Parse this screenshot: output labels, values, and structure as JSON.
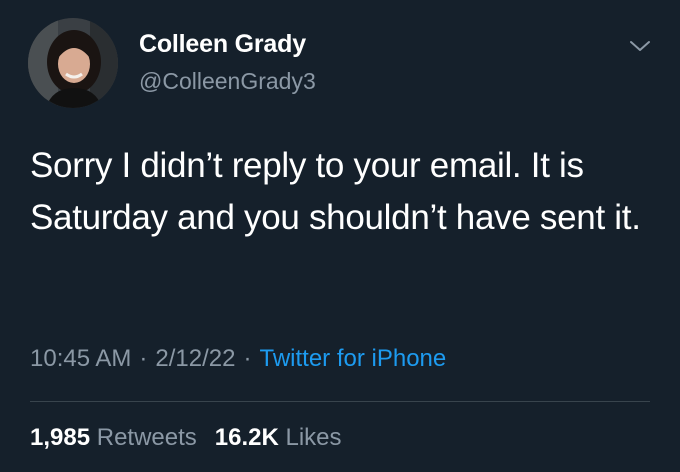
{
  "author": {
    "display_name": "Colleen Grady",
    "handle": "@ColleenGrady3",
    "avatar_icon": "profile-photo"
  },
  "tweet": {
    "text": "Sorry I didn’t reply to your email. It is Saturday and you shouldn’t have sent it.",
    "time": "10:45 AM",
    "date": "2/12/22",
    "separator": "·",
    "source": "Twitter for iPhone"
  },
  "stats": {
    "retweets_count": "1,985",
    "retweets_label": "Retweets",
    "likes_count": "16.2K",
    "likes_label": "Likes"
  },
  "colors": {
    "background": "#15202b",
    "text_primary": "#ffffff",
    "text_secondary": "#8b98a5",
    "link": "#1d9bf0",
    "divider": "#38444d"
  },
  "icons": {
    "more_menu": "chevron-down-icon"
  }
}
